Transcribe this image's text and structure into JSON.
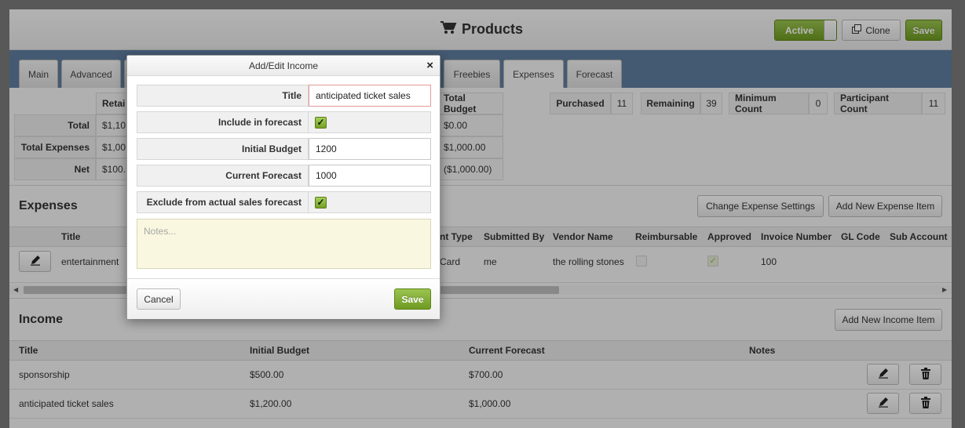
{
  "header": {
    "title": "Products",
    "active_label": "Active",
    "clone_label": "Clone",
    "save_label": "Save"
  },
  "tabs": [
    "Main",
    "Advanced",
    "Freebies",
    "Expenses",
    "Forecast"
  ],
  "budget_table": {
    "col_retail": "Retai",
    "col_total_budget": "Total Budget",
    "rows": [
      {
        "label": "Total",
        "retail": "$1,10",
        "total_budget": "$0.00"
      },
      {
        "label": "Total Expenses",
        "retail": "$1,00",
        "total_budget": "$1,000.00"
      },
      {
        "label": "Net",
        "retail": "$100.",
        "total_budget": "($1,000.00)"
      }
    ]
  },
  "counts": [
    {
      "label": "Purchased",
      "value": "11"
    },
    {
      "label": "Remaining",
      "value": "39"
    },
    {
      "label": "Minimum Count",
      "value": "0"
    },
    {
      "label": "Participant Count",
      "value": "11"
    }
  ],
  "expenses": {
    "title": "Expenses",
    "change_settings_label": "Change Expense Settings",
    "add_item_label": "Add New Expense Item",
    "columns": [
      "Title",
      "nt Type",
      "Submitted By",
      "Vendor Name",
      "Reimbursable",
      "Approved",
      "Invoice Number",
      "GL Code",
      "Sub Account"
    ],
    "row": {
      "title": "entertainment",
      "payment_type": "Card",
      "submitted_by": "me",
      "vendor_name": "the rolling stones",
      "reimbursable": false,
      "approved": true,
      "invoice_number": "100"
    }
  },
  "income": {
    "title": "Income",
    "add_item_label": "Add New Income Item",
    "columns": [
      "Title",
      "Initial Budget",
      "Current Forecast",
      "Notes"
    ],
    "rows": [
      {
        "title": "sponsorship",
        "initial_budget": "$500.00",
        "current_forecast": "$700.00"
      },
      {
        "title": "anticipated ticket sales",
        "initial_budget": "$1,200.00",
        "current_forecast": "$1,000.00"
      }
    ]
  },
  "modal": {
    "title": "Add/Edit Income",
    "close_glyph": "×",
    "fields": {
      "title_label": "Title",
      "title_value": "anticipated ticket sales",
      "include_label": "Include in forecast",
      "include_checked": true,
      "initial_budget_label": "Initial Budget",
      "initial_budget_value": "1200",
      "current_forecast_label": "Current Forecast",
      "current_forecast_value": "1000",
      "exclude_label": "Exclude from actual sales forecast",
      "exclude_checked": true,
      "notes_placeholder": "Notes..."
    },
    "cancel_label": "Cancel",
    "save_label": "Save"
  },
  "colors": {
    "accent_green": "#7fa833",
    "tab_bar": "#5f7d9e",
    "notes_bg": "#f9f7df"
  },
  "icons": {
    "cart": "cart-icon",
    "clone": "clone-icon",
    "edit": "pencil-icon",
    "delete": "trash-icon",
    "check": "checkmark-icon"
  }
}
